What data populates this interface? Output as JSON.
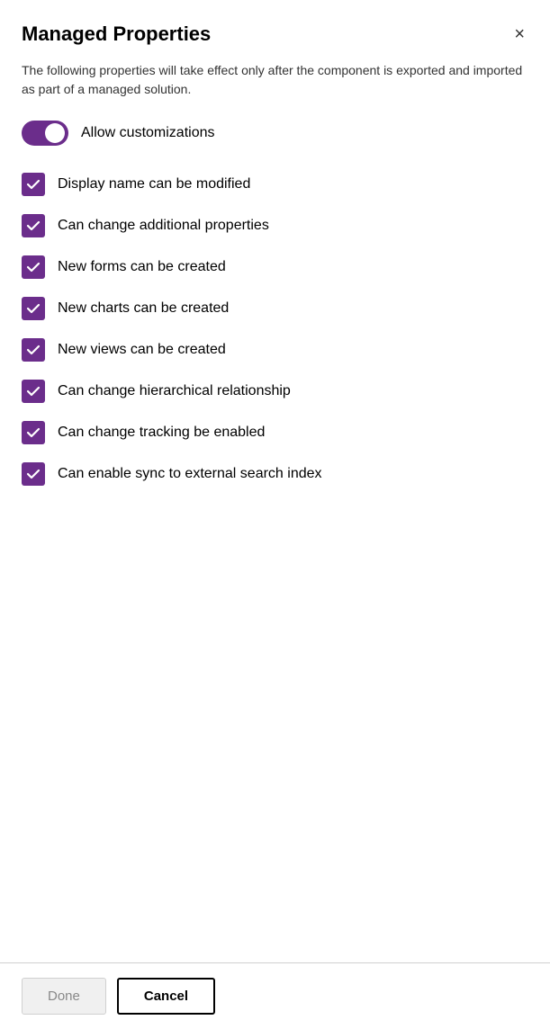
{
  "dialog": {
    "title": "Managed Properties",
    "description": "The following properties will take effect only after the component is exported and imported as part of a managed solution.",
    "close_label": "×"
  },
  "toggle": {
    "label": "Allow customizations",
    "checked": true
  },
  "checkboxes": [
    {
      "label": "Display name can be modified",
      "checked": true
    },
    {
      "label": "Can change additional properties",
      "checked": true
    },
    {
      "label": "New forms can be created",
      "checked": true
    },
    {
      "label": "New charts can be created",
      "checked": true
    },
    {
      "label": "New views can be created",
      "checked": true
    },
    {
      "label": "Can change hierarchical relationship",
      "checked": true
    },
    {
      "label": "Can change tracking be enabled",
      "checked": true
    },
    {
      "label": "Can enable sync to external search index",
      "checked": true
    }
  ],
  "footer": {
    "done_label": "Done",
    "cancel_label": "Cancel"
  },
  "colors": {
    "purple": "#6b2d8b",
    "white": "#ffffff"
  }
}
